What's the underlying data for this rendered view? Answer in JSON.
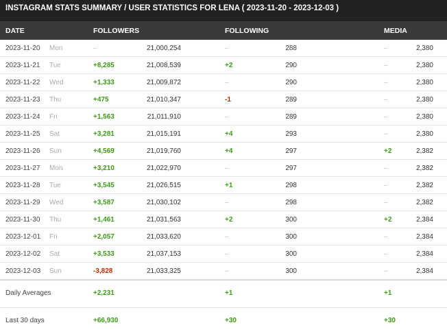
{
  "title": "INSTAGRAM STATS SUMMARY / USER STATISTICS FOR LENA ( 2023-11-20 - 2023-12-03 )",
  "columns": {
    "date": "DATE",
    "followers": "FOLLOWERS",
    "following": "FOLLOWING",
    "media": "MEDIA"
  },
  "rows": [
    {
      "date": "2023-11-20",
      "day": "Mon",
      "fchg": "–",
      "ftot": "21,000,254",
      "gchg": "–",
      "gtot": "288",
      "mchg": "–",
      "mtot": "2,380"
    },
    {
      "date": "2023-11-21",
      "day": "Tue",
      "fchg": "+8,285",
      "ftot": "21,008,539",
      "gchg": "+2",
      "gtot": "290",
      "mchg": "–",
      "mtot": "2,380"
    },
    {
      "date": "2023-11-22",
      "day": "Wed",
      "fchg": "+1,333",
      "ftot": "21,009,872",
      "gchg": "–",
      "gtot": "290",
      "mchg": "–",
      "mtot": "2,380"
    },
    {
      "date": "2023-11-23",
      "day": "Thu",
      "fchg": "+475",
      "ftot": "21,010,347",
      "gchg": "-1",
      "gtot": "289",
      "mchg": "–",
      "mtot": "2,380"
    },
    {
      "date": "2023-11-24",
      "day": "Fri",
      "fchg": "+1,563",
      "ftot": "21,011,910",
      "gchg": "–",
      "gtot": "289",
      "mchg": "–",
      "mtot": "2,380"
    },
    {
      "date": "2023-11-25",
      "day": "Sat",
      "fchg": "+3,281",
      "ftot": "21,015,191",
      "gchg": "+4",
      "gtot": "293",
      "mchg": "–",
      "mtot": "2,380"
    },
    {
      "date": "2023-11-26",
      "day": "Sun",
      "fchg": "+4,569",
      "ftot": "21,019,760",
      "gchg": "+4",
      "gtot": "297",
      "mchg": "+2",
      "mtot": "2,382"
    },
    {
      "date": "2023-11-27",
      "day": "Mon",
      "fchg": "+3,210",
      "ftot": "21,022,970",
      "gchg": "–",
      "gtot": "297",
      "mchg": "–",
      "mtot": "2,382"
    },
    {
      "date": "2023-11-28",
      "day": "Tue",
      "fchg": "+3,545",
      "ftot": "21,026,515",
      "gchg": "+1",
      "gtot": "298",
      "mchg": "–",
      "mtot": "2,382"
    },
    {
      "date": "2023-11-29",
      "day": "Wed",
      "fchg": "+3,587",
      "ftot": "21,030,102",
      "gchg": "–",
      "gtot": "298",
      "mchg": "–",
      "mtot": "2,382"
    },
    {
      "date": "2023-11-30",
      "day": "Thu",
      "fchg": "+1,461",
      "ftot": "21,031,563",
      "gchg": "+2",
      "gtot": "300",
      "mchg": "+2",
      "mtot": "2,384"
    },
    {
      "date": "2023-12-01",
      "day": "Fri",
      "fchg": "+2,057",
      "ftot": "21,033,620",
      "gchg": "–",
      "gtot": "300",
      "mchg": "–",
      "mtot": "2,384"
    },
    {
      "date": "2023-12-02",
      "day": "Sat",
      "fchg": "+3,533",
      "ftot": "21,037,153",
      "gchg": "–",
      "gtot": "300",
      "mchg": "–",
      "mtot": "2,384"
    },
    {
      "date": "2023-12-03",
      "day": "Sun",
      "fchg": "-3,828",
      "ftot": "21,033,325",
      "gchg": "–",
      "gtot": "300",
      "mchg": "–",
      "mtot": "2,384"
    }
  ],
  "daily_averages": {
    "label": "Daily Averages",
    "followers": "+2,231",
    "following": "+1",
    "media": "+1"
  },
  "last_30_days": {
    "label": "Last 30 days",
    "followers": "+66,930",
    "following": "+30",
    "media": "+30"
  },
  "colors": {
    "positive": "#3c9a16",
    "negative": "#cc2a00",
    "neutral": "#bdbdbd",
    "header_bg": "#222222",
    "colhead_bg": "#3a3a3a"
  }
}
